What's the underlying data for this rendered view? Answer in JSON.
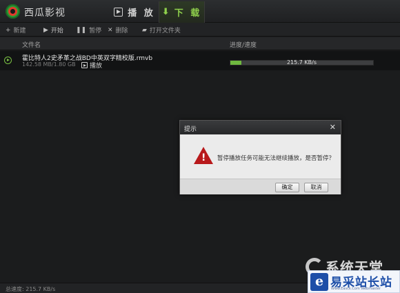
{
  "app": {
    "title": "西瓜影视"
  },
  "tabs": [
    {
      "label": "播 放",
      "icon": "play-icon"
    },
    {
      "label": "下 载",
      "icon": "download-icon",
      "active": true
    }
  ],
  "toolbar": {
    "new_label": "新建",
    "start_label": "开始",
    "pause_label": "暂停",
    "delete_label": "删除",
    "open_folder_label": "打开文件夹"
  },
  "columns": {
    "filename": "文件名",
    "progress": "进度/速度"
  },
  "downloads": [
    {
      "filename": "霍比特人2史矛革之战BD中英双字精校版.rmvb",
      "size": "142.58 MB/1.80 GB",
      "play_label": "播放",
      "progress": 0.077,
      "speed": "215.7 KB/s"
    }
  ],
  "dialog": {
    "title": "提示",
    "message": "暂停播放任务可能无法继续播放，是否暂停？",
    "ok_label": "确定",
    "cancel_label": "取消"
  },
  "status": {
    "total_speed": "总速度: 215.7 KB/s"
  },
  "watermarks": {
    "top": "系统天堂",
    "bottom": "易采站长站",
    "bottom_sub": "Www.Easck.Com Webmaster"
  },
  "colors": {
    "accent": "#7ac143",
    "warning": "#b8191b",
    "progress": "#6fb83f"
  }
}
